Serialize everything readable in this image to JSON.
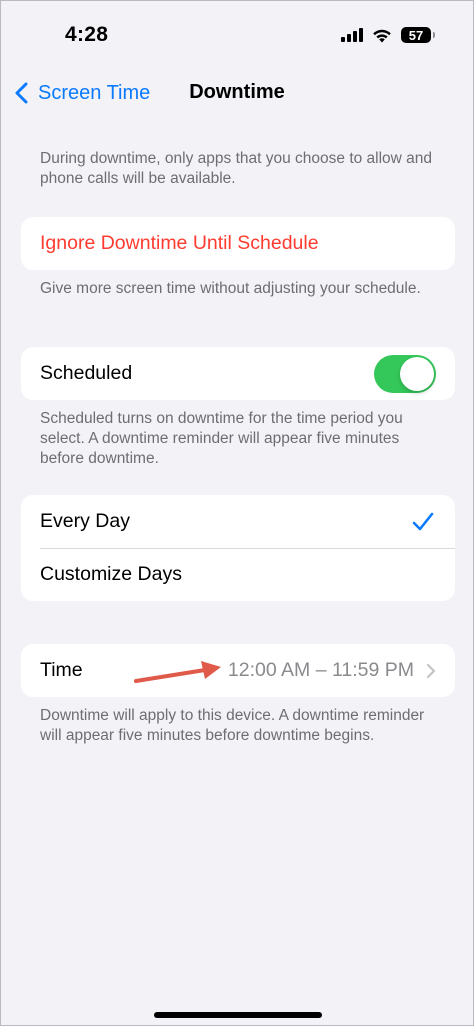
{
  "status_bar": {
    "time": "4:28",
    "battery": "57",
    "icons": [
      "cellular-signal-icon",
      "wifi-icon",
      "battery-icon"
    ]
  },
  "nav": {
    "back_label": "Screen Time",
    "title": "Downtime"
  },
  "intro_text": "During downtime, only apps that you choose to allow and phone calls will be available.",
  "ignore": {
    "label": "Ignore Downtime Until Schedule",
    "footer": "Give more screen time without adjusting your schedule."
  },
  "scheduled": {
    "label": "Scheduled",
    "enabled": true,
    "footer": "Scheduled turns on downtime for the time period you select. A downtime reminder will appear five minutes before downtime."
  },
  "days": {
    "options": [
      {
        "label": "Every Day",
        "selected": true
      },
      {
        "label": "Customize Days",
        "selected": false
      }
    ]
  },
  "time": {
    "label": "Time",
    "value": "12:00 AM – 11:59 PM",
    "footer": "Downtime will apply to this device. A downtime reminder will appear five minutes before downtime begins."
  },
  "colors": {
    "accent": "#0a7aff",
    "destructive": "#ff3b30",
    "toggle_on": "#34c759",
    "annotation_arrow": "#e05a4a"
  }
}
